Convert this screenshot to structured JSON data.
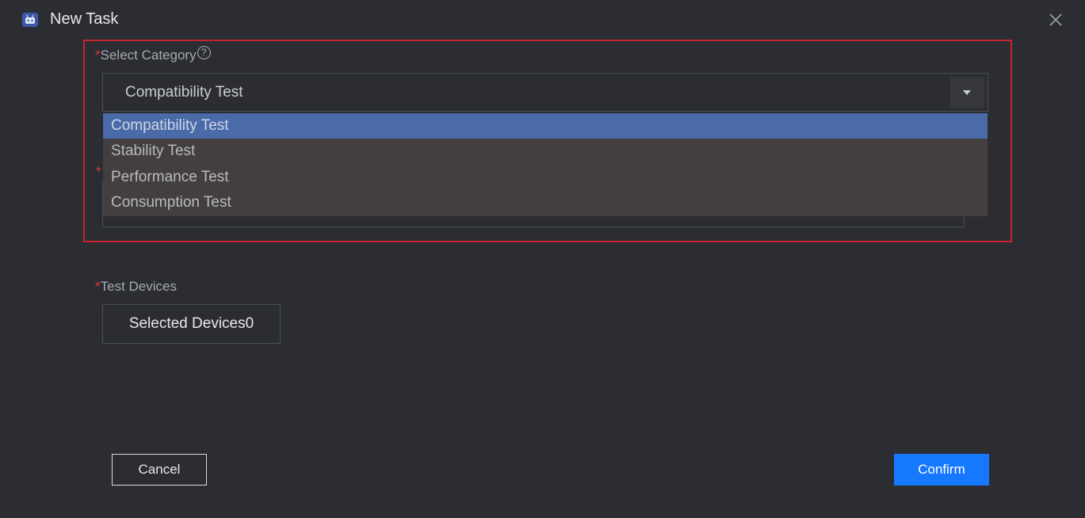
{
  "window": {
    "title": "New Task"
  },
  "category": {
    "label": "Select Category",
    "required_mark": "*",
    "help_icon": "question-circle-icon",
    "selected_value": "Compatibility Test",
    "options": [
      "Compatibility Test",
      "Stability Test",
      "Performance Test",
      "Consumption Test"
    ],
    "selected_index": 0
  },
  "hidden_field": {
    "required_mark": "*"
  },
  "devices": {
    "label": "Test Devices",
    "required_mark": "*",
    "button_label": "Selected Devices0"
  },
  "footer": {
    "cancel_label": "Cancel",
    "confirm_label": "Confirm"
  },
  "colors": {
    "accent": "#1677ff",
    "highlight_border": "#c5242c",
    "selected_option": "#4a6aa8"
  }
}
